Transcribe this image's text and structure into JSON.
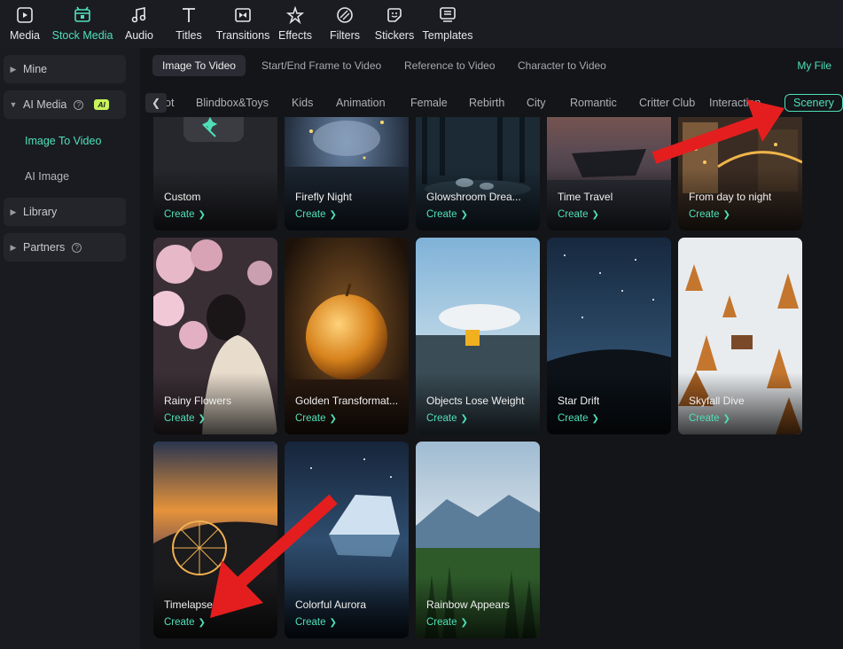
{
  "toolbar": {
    "items": [
      {
        "label": "Media",
        "icon": "media-icon"
      },
      {
        "label": "Stock Media",
        "icon": "stock-media-icon",
        "active": true
      },
      {
        "label": "Audio",
        "icon": "audio-icon"
      },
      {
        "label": "Titles",
        "icon": "titles-icon"
      },
      {
        "label": "Transitions",
        "icon": "transitions-icon"
      },
      {
        "label": "Effects",
        "icon": "effects-icon"
      },
      {
        "label": "Filters",
        "icon": "filters-icon"
      },
      {
        "label": "Stickers",
        "icon": "stickers-icon"
      },
      {
        "label": "Templates",
        "icon": "templates-icon"
      }
    ]
  },
  "sidebar": {
    "mine": "Mine",
    "ai_media": "AI Media",
    "ai_badge": "AI",
    "image_to_video": "Image To Video",
    "ai_image": "AI Image",
    "library": "Library",
    "partners": "Partners"
  },
  "tabs": {
    "items": [
      "Image To Video",
      "Start/End Frame to Video",
      "Reference to Video",
      "Character to Video"
    ],
    "my_file": "My File"
  },
  "categories": {
    "prev_icon": "chevron-left-icon",
    "items": [
      "ot",
      "Blindbox&Toys",
      "Kids",
      "Animation",
      "Female",
      "Rebirth",
      "City",
      "Romantic",
      "Critter Club",
      "Interaction",
      "Scenery"
    ],
    "active": "Scenery"
  },
  "cards": [
    {
      "title": "Custom",
      "create": "Create"
    },
    {
      "title": "Firefly Night",
      "create": "Create"
    },
    {
      "title": "Glowshroom Drea...",
      "create": "Create"
    },
    {
      "title": "Time Travel",
      "create": "Create"
    },
    {
      "title": "From day to night",
      "create": "Create"
    },
    {
      "title": "Rainy Flowers",
      "create": "Create"
    },
    {
      "title": "Golden Transformat...",
      "create": "Create"
    },
    {
      "title": "Objects Lose Weight",
      "create": "Create"
    },
    {
      "title": "Star Drift",
      "create": "Create"
    },
    {
      "title": "Skyfall Dive",
      "create": "Create"
    },
    {
      "title": "Timelapse",
      "create": "Create",
      "selected": true
    },
    {
      "title": "Colorful Aurora",
      "create": "Create"
    },
    {
      "title": "Rainbow Appears",
      "create": "Create"
    }
  ],
  "colors": {
    "accent": "#4fe0b8",
    "arrow": "#e41e1e",
    "ai_badge": "#c7f45a"
  }
}
